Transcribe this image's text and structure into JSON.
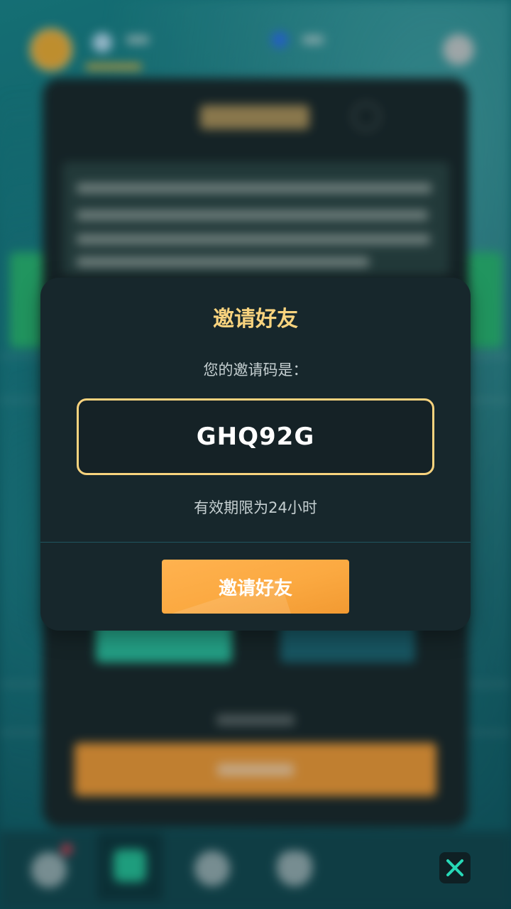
{
  "modal": {
    "title": "邀请好友",
    "label": "您的邀请码是：",
    "code": "GHQ92G",
    "validity": "有效期限为24小时",
    "button_label": "邀请好友"
  },
  "colors": {
    "title_gold": "#f8d37e",
    "button_orange": "#fba941",
    "modal_bg": "#17272c",
    "close_icon": "#27d8b7"
  },
  "icons": {
    "close": "close-icon",
    "coin": "coin-icon",
    "gem": "gem-icon",
    "settings": "gear-icon"
  }
}
